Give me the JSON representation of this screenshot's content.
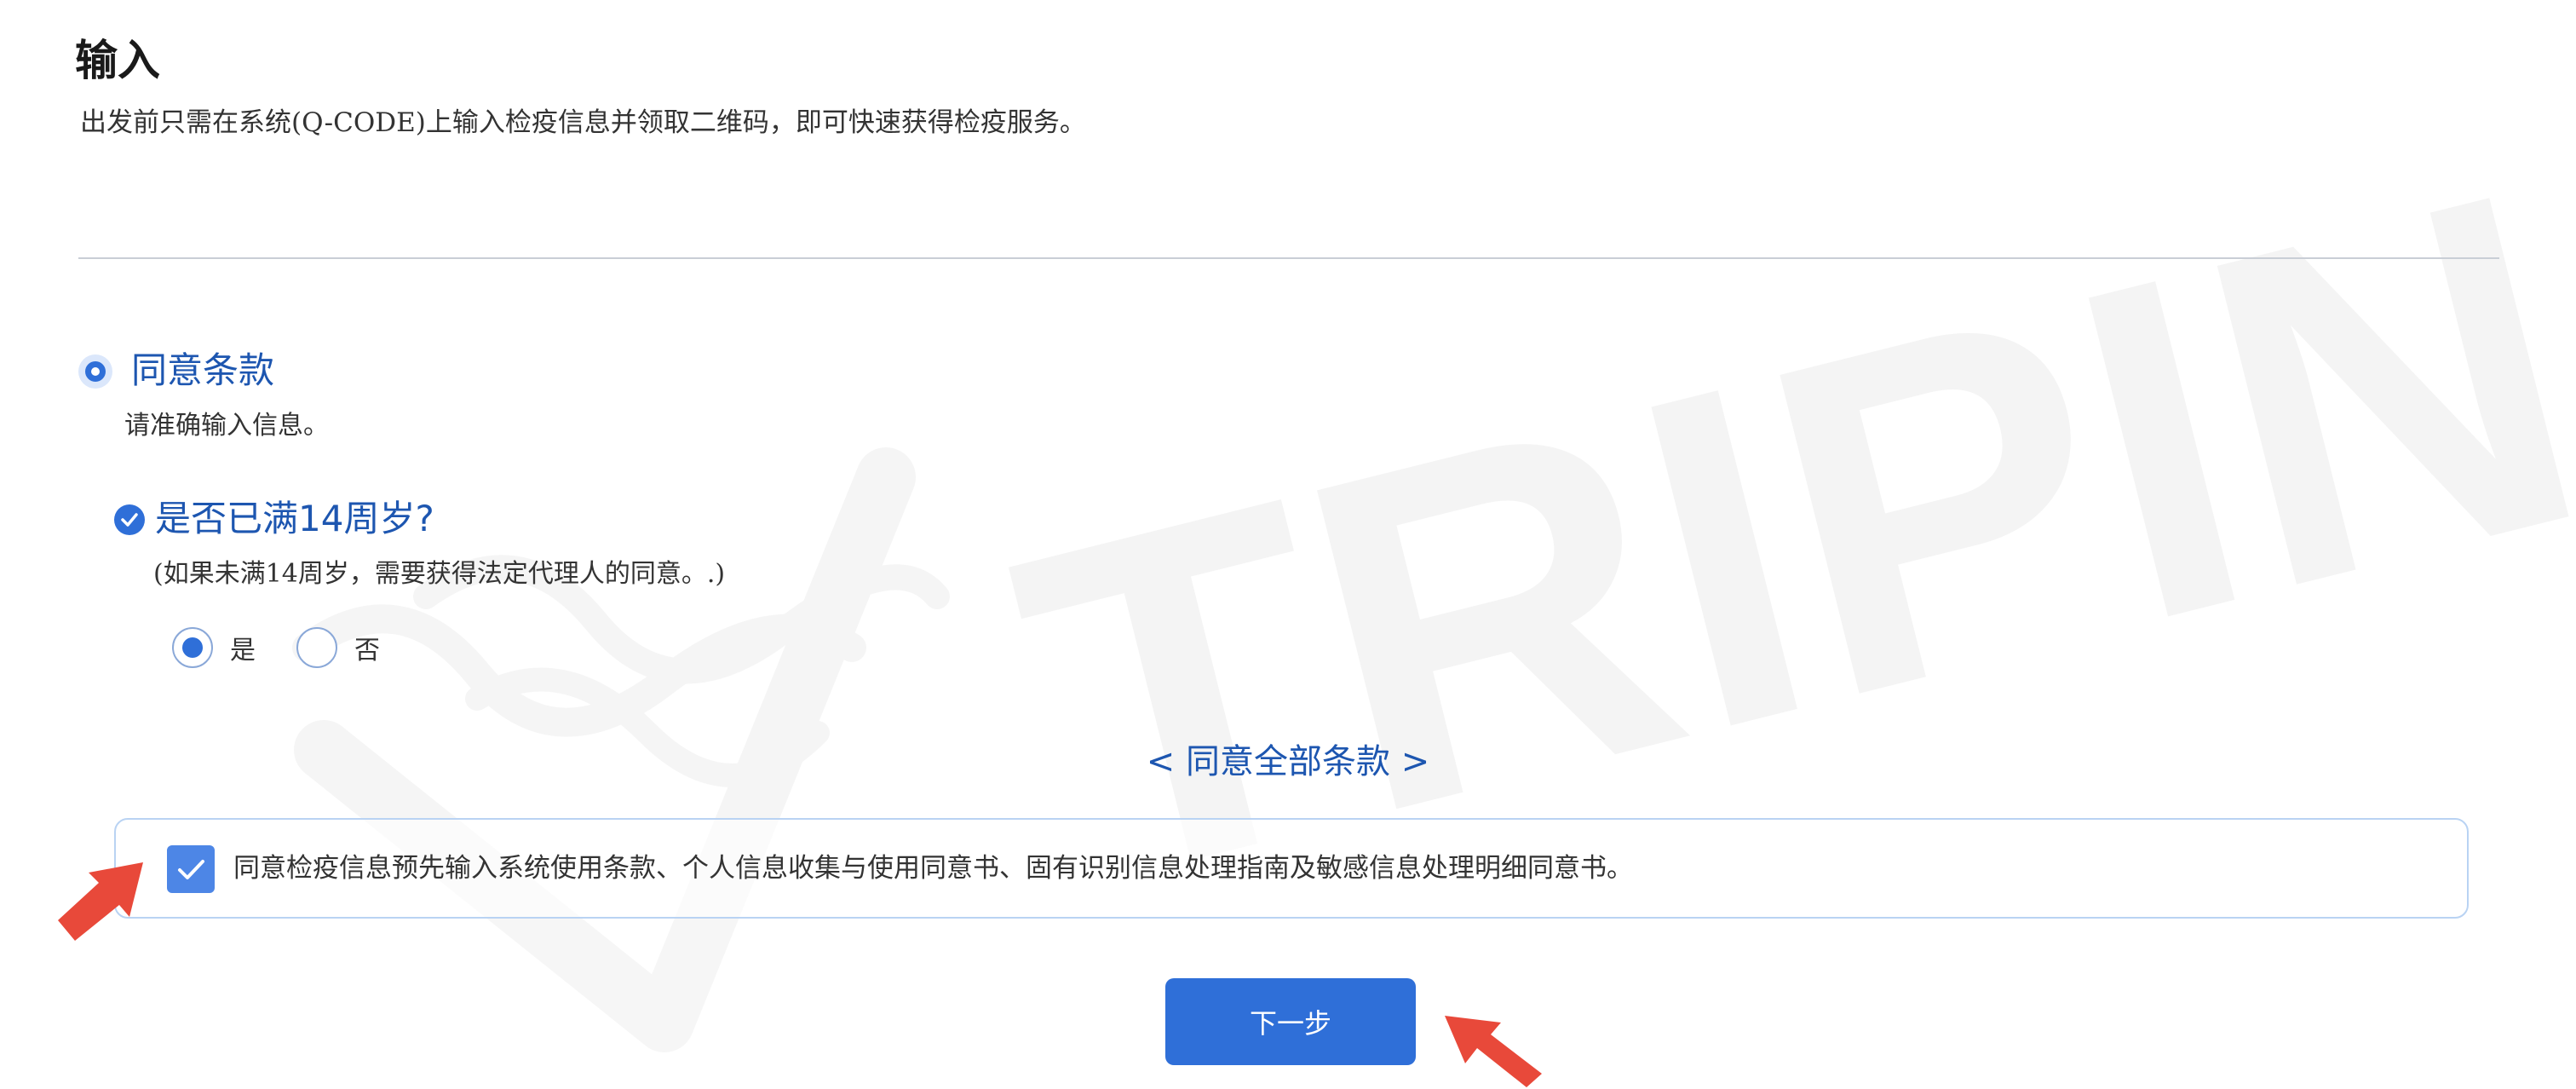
{
  "page": {
    "title": "输入",
    "description": "出发前只需在系统(Q-CODE)上输入检疫信息并领取二维码，即可快速获得检疫服务。"
  },
  "section": {
    "title": "同意条款",
    "subtitle": "请准确输入信息。"
  },
  "age_question": {
    "title": "是否已满14周岁?",
    "note": "(如果未满14周岁，需要获得法定代理人的同意。.)",
    "options": [
      {
        "label": "是",
        "selected": true
      },
      {
        "label": "否",
        "selected": false
      }
    ]
  },
  "agree_all_link": "< 同意全部条款 >",
  "consent": {
    "checked": true,
    "text": "同意检疫信息预先输入系统使用条款、个人信息收集与使用同意书、固有识别信息处理指南及敏感信息处理明细同意书。"
  },
  "next_button_label": "下一步",
  "watermark_text": "TRIPIN",
  "colors": {
    "accent": "#2f6fd8",
    "link_text": "#1d56b0",
    "consent_border": "#b9d3f3",
    "annotation_arrow": "#e8493a"
  }
}
